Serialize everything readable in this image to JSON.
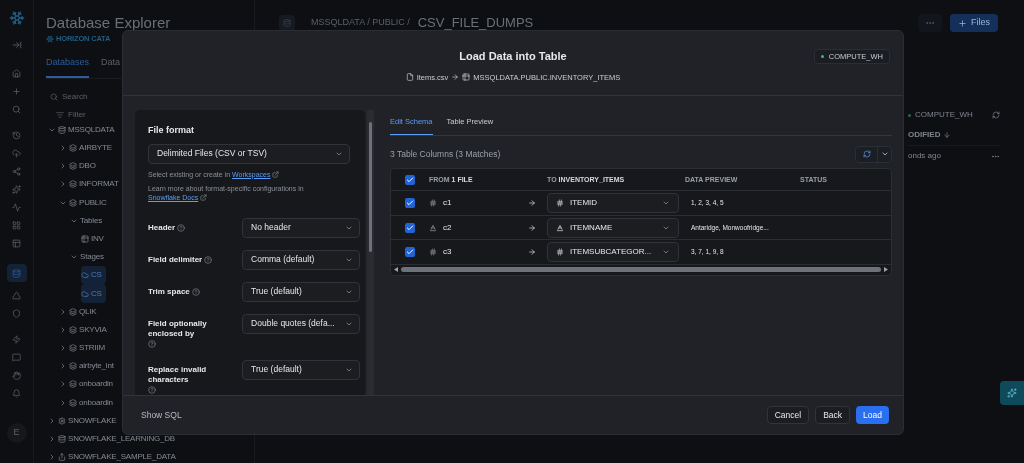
{
  "rail": [
    {
      "selected": false
    },
    {
      "selected": false
    },
    {
      "selected": false
    },
    {
      "selected": false
    },
    {
      "selected": false
    },
    {
      "selected": false
    },
    {
      "selected": false
    },
    {
      "selected": false
    },
    {
      "selected": false
    },
    {
      "selected": false
    },
    {
      "selected": true
    },
    {
      "selected": false
    },
    {
      "selected": false
    },
    {
      "selected": false
    },
    {
      "selected": false
    },
    {
      "selected": false
    },
    {
      "selected": false
    }
  ],
  "user_initial": "E",
  "sidebar": {
    "title": "Database Explorer",
    "subtitle": "HORIZON CATA",
    "tabs": [
      {
        "label": "Databases",
        "selected": true
      },
      {
        "label": "Data",
        "selected": false
      }
    ],
    "search": {
      "placeholder": "Search"
    },
    "filter": "Filter",
    "tree": [
      {
        "label": "MSSQLDATA",
        "kind": "database",
        "expanded": true,
        "selected": false,
        "children": [
          {
            "label": "AIRBYTE",
            "kind": "schema",
            "expanded": false,
            "selected": false
          },
          {
            "label": "DBO",
            "kind": "schema",
            "expanded": false,
            "selected": false
          },
          {
            "label": "INFORMAT",
            "kind": "schema",
            "expanded": false,
            "selected": false
          },
          {
            "label": "PUBLIC",
            "kind": "schema",
            "expanded": true,
            "selected": false,
            "children": [
              {
                "label": "Tables",
                "kind": "group",
                "expanded": true,
                "selected": false,
                "children": [
                  {
                    "label": "INV",
                    "kind": "table",
                    "selected": false
                  }
                ]
              },
              {
                "label": "Stages",
                "kind": "group",
                "expanded": true,
                "selected": false,
                "children": [
                  {
                    "label": "CS",
                    "kind": "stage",
                    "selected": true
                  },
                  {
                    "label": "CS",
                    "kind": "stage",
                    "selected": true
                  }
                ]
              }
            ]
          },
          {
            "label": "QLIK",
            "kind": "schema",
            "expanded": false,
            "selected": false
          },
          {
            "label": "SKYVIA",
            "kind": "schema",
            "expanded": false,
            "selected": false
          },
          {
            "label": "STRIIM",
            "kind": "schema",
            "expanded": false,
            "selected": false
          },
          {
            "label": "airbyte_int",
            "kind": "schema",
            "expanded": false,
            "selected": false
          },
          {
            "label": "onboardin",
            "kind": "schema",
            "expanded": false,
            "selected": false
          },
          {
            "label": "onboardin",
            "kind": "schema",
            "expanded": false,
            "selected": false
          }
        ]
      },
      {
        "label": "SNOWFLAKE",
        "kind": "system_db",
        "expanded": false,
        "selected": false
      },
      {
        "label": "SNOWFLAKE_LEARNING_DB",
        "kind": "database",
        "expanded": false,
        "selected": false
      },
      {
        "label": "SNOWFLAKE_SAMPLE_DATA",
        "kind": "shared_db",
        "expanded": false,
        "selected": false
      }
    ]
  },
  "main": {
    "breadcrumb": "MSSQLDATA / PUBLIC /",
    "stage_name": "CSV_FILE_DUMPS",
    "add_button": "Files",
    "warehouse": "COMPUTE_WH",
    "column_header": "ODIFIED",
    "cell": "onds ago"
  },
  "dialog": {
    "title": "Load Data into Table",
    "source_file": "Items.csv",
    "target_table": "MSSQLDATA.PUBLIC.INVENTORY_ITEMS",
    "warehouse": "COMPUTE_WH",
    "file_format": {
      "label": "File format",
      "value": "Delimited Files (CSV or TSV)"
    },
    "hints": [
      {
        "text": "Select existing or create in",
        "link": "Workspaces"
      },
      {
        "text": "Learn more about format-specific configurations in",
        "link": "Snowflake Docs"
      }
    ],
    "fields": [
      {
        "label": "Header",
        "value": "No header"
      },
      {
        "label": "Field delimiter",
        "value": "Comma (default)"
      },
      {
        "label": "Trim space",
        "value": "True (default)"
      },
      {
        "label": "Field optionally enclosed by",
        "value": "Double quotes (defa..."
      },
      {
        "label": "Replace invalid characters",
        "value": "True (default)"
      }
    ],
    "tabs": [
      {
        "label": "Edit Schema",
        "selected": true
      },
      {
        "label": "Table Preview",
        "selected": false
      }
    ],
    "column_summary": "3 Table Columns (3 Matches)",
    "table": {
      "all_checked": true,
      "columns": [
        "FROM **1 FILE**",
        "TO **INVENTORY_ITEMS**",
        "DATA PREVIEW",
        "STATUS"
      ],
      "rows": [
        {
          "checked": true,
          "kind": "number",
          "source": "c1",
          "target": "ITEMID",
          "preview": "1, 2, 3, 4, 5"
        },
        {
          "checked": true,
          "kind": "text",
          "source": "c2",
          "target": "ITEMNAME",
          "preview": "Antaridge, Monwoofridge..."
        },
        {
          "checked": true,
          "kind": "number",
          "source": "c3",
          "target": "ITEMSUBCATEGOR...",
          "preview": "3, 7, 1, 9, 8"
        }
      ]
    },
    "footer": {
      "link": "Show SQL",
      "buttons": [
        {
          "label": "Cancel",
          "kind": "secondary"
        },
        {
          "label": "Back",
          "kind": "secondary"
        },
        {
          "label": "Load",
          "kind": "primary"
        }
      ]
    }
  }
}
